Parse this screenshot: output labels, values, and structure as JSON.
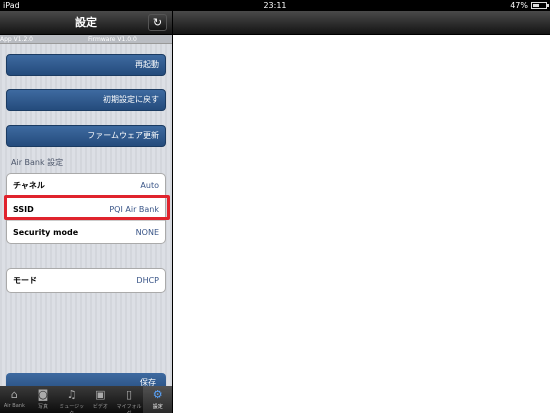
{
  "status": {
    "device": "iPad",
    "time": "23:11",
    "battery": "47%"
  },
  "nav": {
    "title": "設定"
  },
  "versions": {
    "app": "App V1.2.0",
    "firmware": "Firmware V1.0.0"
  },
  "actions": {
    "reboot": "再起動",
    "reset": "初期設定に戻す",
    "firmware_update": "ファームウェア更新"
  },
  "section": {
    "airbank": "Air Bank 設定"
  },
  "settings": {
    "channel": {
      "label": "チャネル",
      "value": "Auto"
    },
    "ssid": {
      "label": "SSID",
      "value": "PQI Air Bank"
    },
    "security": {
      "label": "Security mode",
      "value": "NONE"
    },
    "mode": {
      "label": "モード",
      "value": "DHCP"
    }
  },
  "save_label": "保存",
  "tabs": [
    {
      "label": "Air Bank",
      "icon": "airbank-icon"
    },
    {
      "label": "写真",
      "icon": "camera-icon"
    },
    {
      "label": "ミュージック",
      "icon": "music-icon"
    },
    {
      "label": "ビデオ",
      "icon": "video-icon"
    },
    {
      "label": "マイフォルダ",
      "icon": "folder-icon"
    },
    {
      "label": "設定",
      "icon": "gear-icon"
    }
  ],
  "colors": {
    "accent": "#2f5a8e",
    "highlight": "#e0232d"
  }
}
